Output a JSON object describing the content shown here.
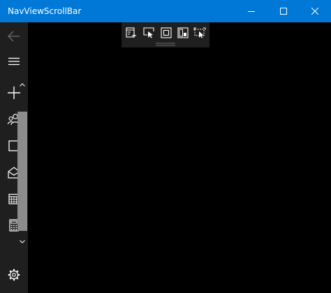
{
  "window": {
    "title": "NavViewScrollBar",
    "accent": "#0078d7",
    "caption_buttons": [
      "minimize-icon",
      "maximize-icon",
      "close-icon"
    ]
  },
  "nav": {
    "background": "#1f1f1f",
    "items": [
      {
        "icon": "back-arrow-icon",
        "state": "disabled"
      },
      {
        "icon": "hamburger-menu-icon"
      },
      {
        "icon": "add-icon"
      },
      {
        "icon": "people-icon"
      },
      {
        "icon": "square-icon"
      },
      {
        "icon": "mail-open-icon"
      },
      {
        "icon": "calendar-icon"
      },
      {
        "icon": "calculator-icon"
      }
    ],
    "footer": {
      "icon": "gear-icon"
    },
    "scrollbar": {
      "thumb_color": "#8c8c8c",
      "buttons": [
        "chevron-up-icon",
        "chevron-down-icon"
      ]
    }
  },
  "debug_toolbar": {
    "tools": [
      "live-visual-tree-icon",
      "select-element-icon",
      "display-layout-adorners-icon",
      "track-focus-icon",
      "preview-selection-icon"
    ],
    "grip": "toolbar-grip-icon"
  },
  "content": {
    "background": "#000000"
  }
}
